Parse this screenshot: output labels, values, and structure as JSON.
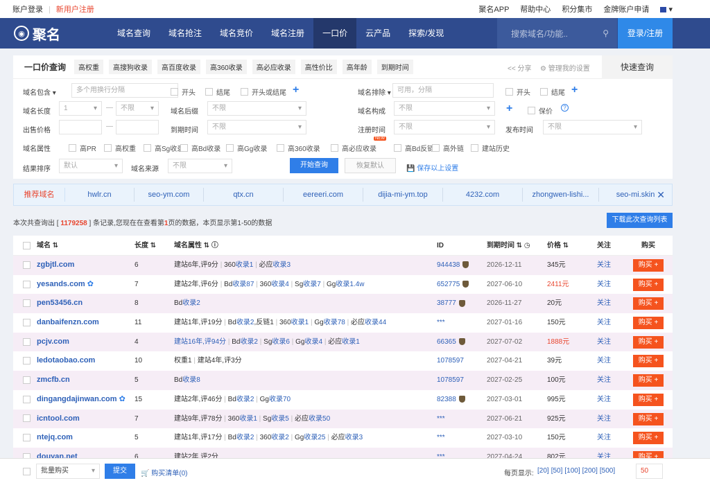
{
  "topbar": {
    "login": "账户登录",
    "register": "新用户注册",
    "links": [
      "聚名APP",
      "帮助中心",
      "积分集市",
      "金牌账户申请"
    ]
  },
  "nav": {
    "logo": "聚名",
    "menu": [
      "域名查询",
      "域名抢注",
      "域名竞价",
      "域名注册",
      "一口价",
      "云产品",
      "探索/发现"
    ],
    "active_index": 4,
    "search_placeholder": "搜索域名/功能..",
    "login": "登录/注册"
  },
  "panel": {
    "title": "一口价查询",
    "tabs": [
      "高权重",
      "高搜狗收录",
      "高百度收录",
      "高360收录",
      "高必应收录",
      "高性价比",
      "高年龄",
      "到期时间"
    ],
    "share": "分享",
    "manage": "管理我的设置",
    "quick": "快速查询",
    "labels": {
      "contains": "域名包含",
      "exclude": "域名排除",
      "length": "域名长度",
      "suffix": "域名后缀",
      "structure": "域名构成",
      "price": "出售价格",
      "expire": "到期时间",
      "reg": "注册时间",
      "pub": "发布时间",
      "attr": "域名属性",
      "sort": "结果排序",
      "source": "域名来源"
    },
    "contains_placeholder": "多个用换行分隔",
    "exclude_placeholder": "可用，分隔",
    "length_from": "1",
    "length_to": "不限",
    "unlimited": "不限",
    "default_sort": "默认",
    "cb_start": "开头",
    "cb_end": "结尾",
    "cb_startend": "开头或结尾",
    "cb_baojia": "保价",
    "attrs": [
      "高PR",
      "高权重",
      "高Sg收录",
      "高Bd收录",
      "高Gg收录",
      "高360收录",
      "高必应收录",
      "高Bd反链",
      "高外链",
      "建站历史"
    ],
    "new_badge": "NEW",
    "search_btn": "开始查询",
    "reset_btn": "恢复默认",
    "save": "保存以上设置"
  },
  "recommend": {
    "title": "推荐域名",
    "items": [
      "hwlr.cn",
      "seo-ym.com",
      "qtx.cn",
      "eereeri.com",
      "dijia-mi-ym.top",
      "4232.com",
      "zhongwen-lishi...",
      "seo-mi.skin"
    ]
  },
  "summary": {
    "prefix": "本次共查询出 [ ",
    "count": "1179258",
    "mid": " ] 条记录,您现在在查看第",
    "page": "1",
    "suffix": "页的数据，本页显示第1-50的数据"
  },
  "download": "下载此次查询列表",
  "table": {
    "headers": {
      "name": "域名",
      "length": "长度",
      "attr": "域名属性",
      "id": "ID",
      "expire": "到期时间",
      "price": "价格",
      "follow": "关注",
      "buy": "购买"
    },
    "buy_label": "购买 +",
    "follow_label": "关注",
    "rows": [
      {
        "name": "zgbjtl.com",
        "len": "6",
        "attr": "建站6年,评9分 | 360收录1 | 必应收录3",
        "id": "944438",
        "guard": true,
        "expire": "2026-12-11",
        "price": "345元",
        "hot": false,
        "paw": false
      },
      {
        "name": "yesands.com",
        "len": "7",
        "attr": "建站2年,评6分 | Bd收录87 | 360收录4 | Sg收录7 | Gg收录1.4w",
        "id": "652775",
        "guard": true,
        "expire": "2027-06-10",
        "price": "2411元",
        "hot": true,
        "paw": true
      },
      {
        "name": "pen53456.cn",
        "len": "8",
        "attr": "Bd收录2",
        "id": "38777",
        "guard": true,
        "expire": "2026-11-27",
        "price": "20元",
        "hot": false,
        "paw": false
      },
      {
        "name": "danbaifenzn.com",
        "len": "11",
        "attr": "建站1年,评19分 | Bd收录2,反链1 | 360收录1 | Gg收录78 | 必应收录44",
        "id": "***",
        "guard": false,
        "expire": "2027-01-16",
        "price": "150元",
        "hot": false,
        "paw": false
      },
      {
        "name": "pcjv.com",
        "len": "4",
        "attr": "建站16年,评94分 | Bd收录2 | Sg收录6 | Gg收录4 | 必应收录1",
        "id": "66365",
        "guard": true,
        "expire": "2027-07-02",
        "price": "1888元",
        "hot": true,
        "paw": false
      },
      {
        "name": "ledotaobao.com",
        "len": "10",
        "attr": "权重1 | 建站4年,评3分",
        "id": "1078597",
        "guard": false,
        "expire": "2027-04-21",
        "price": "39元",
        "hot": false,
        "paw": false
      },
      {
        "name": "zmcfb.cn",
        "len": "5",
        "attr": "Bd收录8",
        "id": "1078597",
        "guard": false,
        "expire": "2027-02-25",
        "price": "100元",
        "hot": false,
        "paw": false
      },
      {
        "name": "dingangdajinwan.com",
        "len": "15",
        "attr": "建站2年,评46分 | Bd收录2 | Gg收录70",
        "id": "82388",
        "guard": true,
        "expire": "2027-03-01",
        "price": "995元",
        "hot": false,
        "paw": true
      },
      {
        "name": "icntool.com",
        "len": "7",
        "attr": "建站9年,评78分 | 360收录1 | Sg收录5 | 必应收录50",
        "id": "***",
        "guard": false,
        "expire": "2027-06-21",
        "price": "925元",
        "hot": false,
        "paw": false
      },
      {
        "name": "ntejq.com",
        "len": "5",
        "attr": "建站1年,评17分 | Bd收录2 | 360收录2 | Gg收录25 | 必应收录3",
        "id": "***",
        "guard": false,
        "expire": "2027-03-10",
        "price": "150元",
        "hot": false,
        "paw": false
      },
      {
        "name": "douyan.net",
        "len": "6",
        "attr": "建站2年,评2分",
        "id": "***",
        "guard": false,
        "expire": "2027-04-24",
        "price": "802元",
        "hot": false,
        "paw": false
      }
    ]
  },
  "footer": {
    "batch": "批量购买",
    "submit": "提交",
    "cart": "购买清单(0)",
    "per_page": "每页显示:",
    "options": [
      "[20]",
      "[50]",
      "[100]",
      "[200]",
      "[500]"
    ],
    "page_value": "50"
  },
  "colors": {
    "nav": "#2f4b8e",
    "accent": "#2f7ee8",
    "buy": "#f5531e",
    "red": "#e8452e",
    "row_alt": "#f6edf6"
  }
}
